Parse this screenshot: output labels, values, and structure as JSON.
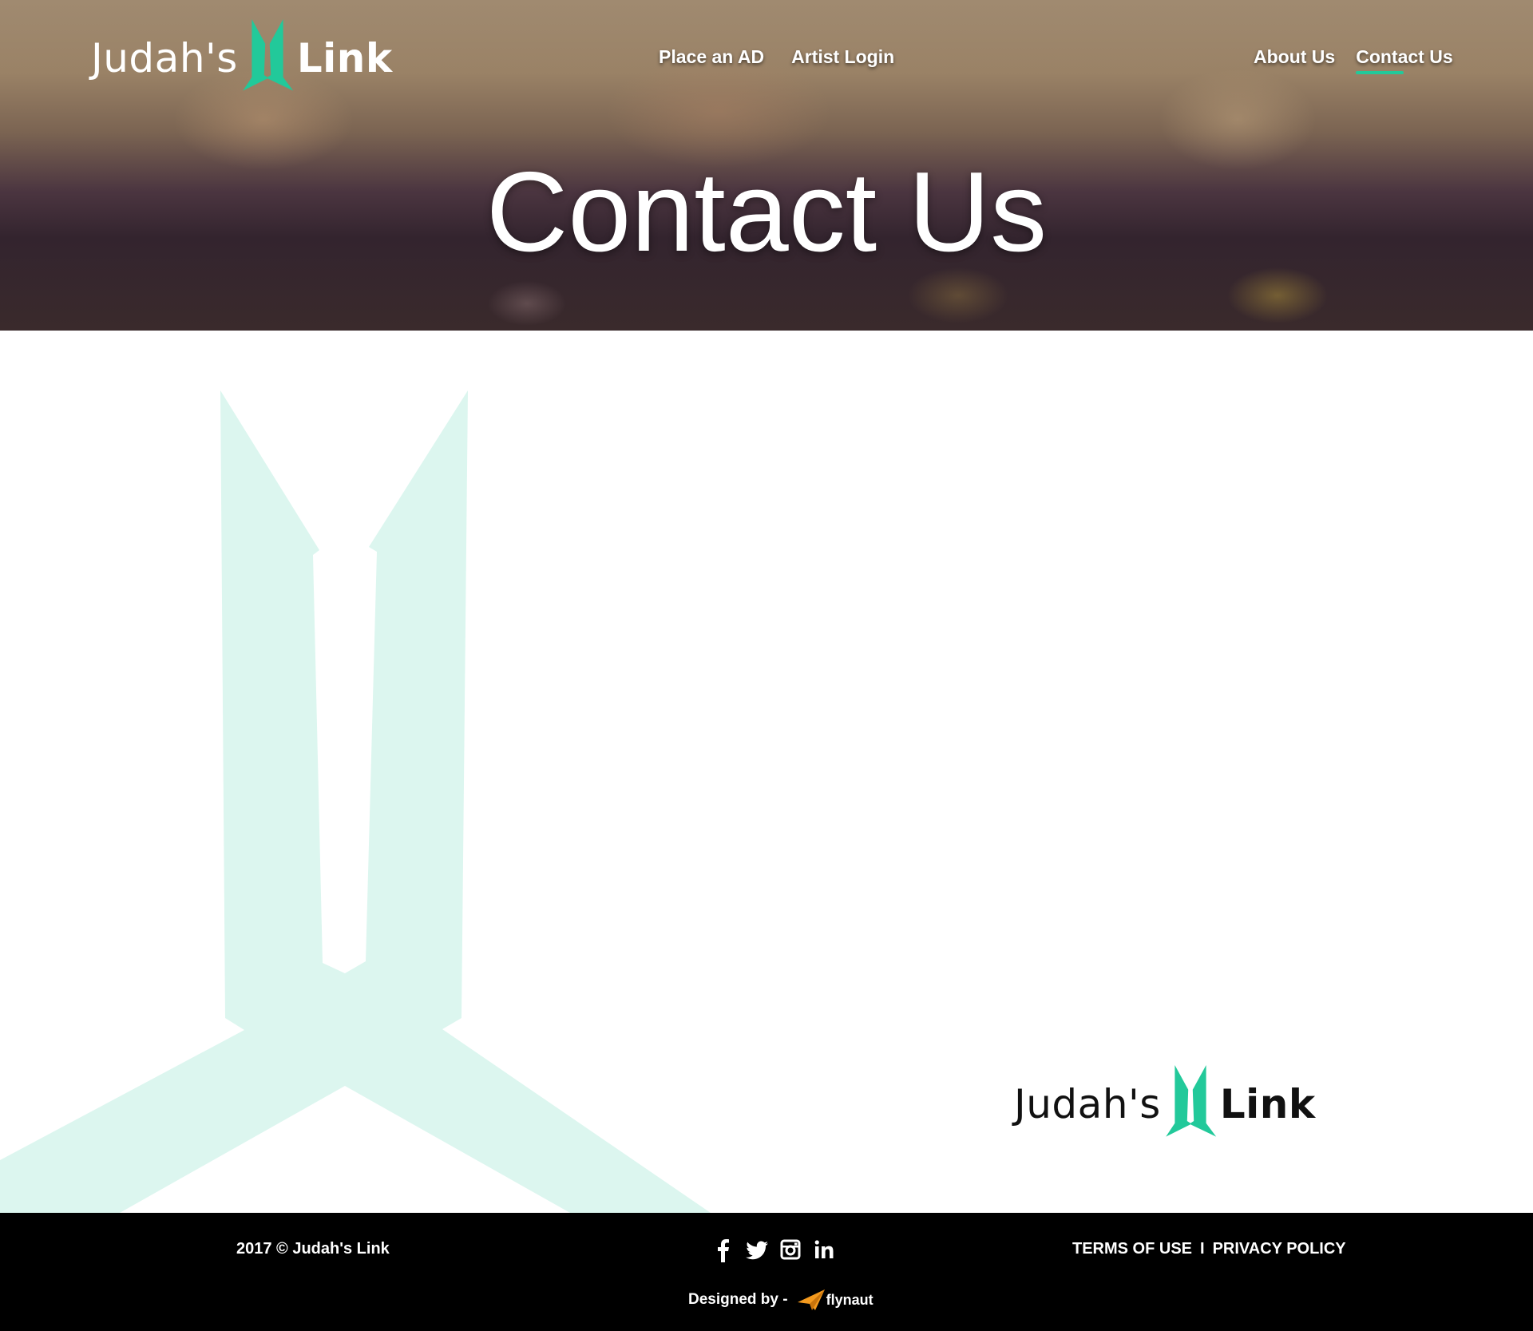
{
  "brand": {
    "name_left": "Judah's",
    "name_right": "Link",
    "accent_color": "#22c99a"
  },
  "nav": {
    "center": [
      {
        "label": "Place an AD"
      },
      {
        "label": "Artist Login"
      }
    ],
    "right": [
      {
        "label": "About Us"
      },
      {
        "label": "Contact Us",
        "active": true
      }
    ]
  },
  "hero": {
    "title": "Contact Us"
  },
  "footer": {
    "copyright": "2017 © Judah's Link",
    "social_icons": [
      "facebook-icon",
      "twitter-icon",
      "instagram-icon",
      "linkedin-icon"
    ],
    "legal": {
      "terms": "TERMS OF USE",
      "separator": "I",
      "privacy": "PRIVACY POLICY"
    },
    "designed_by": "Designed by -",
    "designer": "flynaut"
  }
}
